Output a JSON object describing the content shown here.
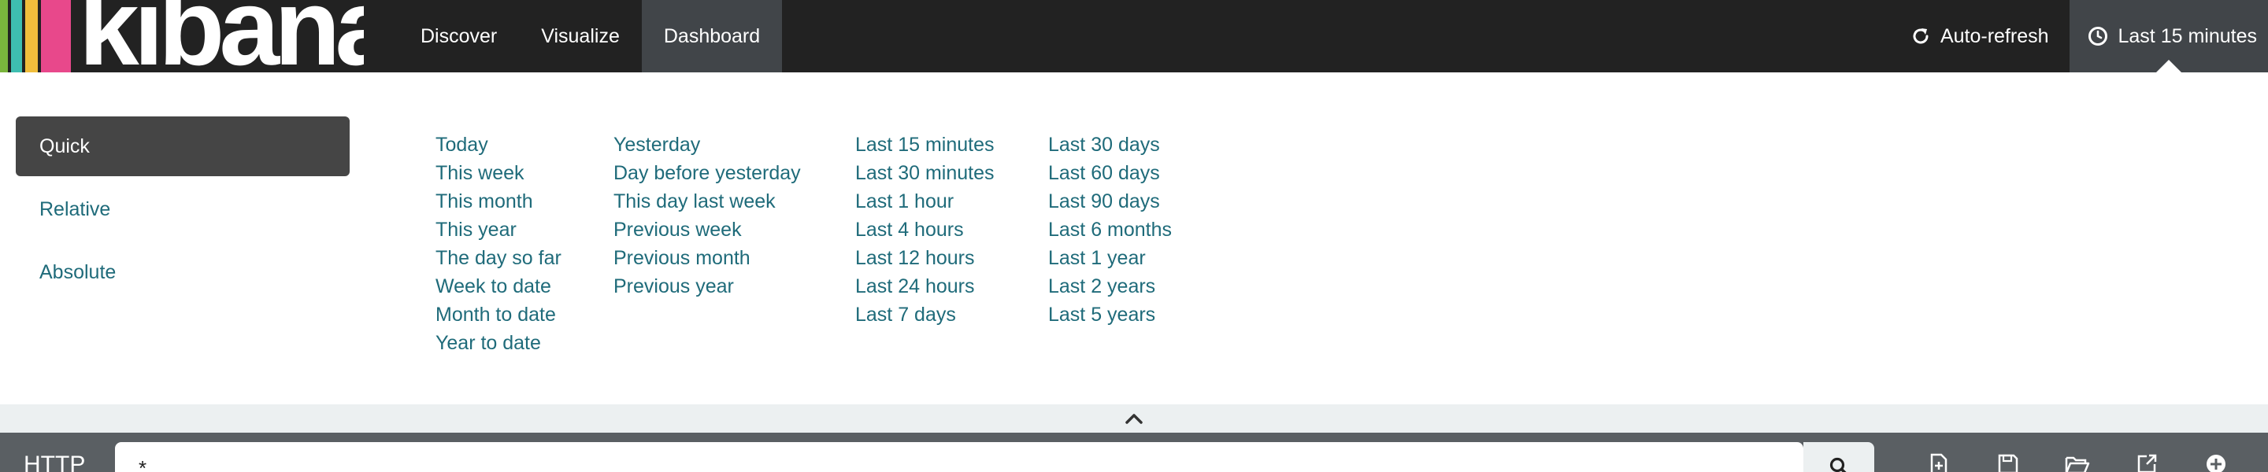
{
  "nav": {
    "logo_text": "kibana",
    "logo_stripes": [
      "#e8488b",
      "#f0be3c",
      "#3ebeb0",
      "#7ab53d"
    ],
    "tabs": [
      {
        "label": "Discover",
        "active": false
      },
      {
        "label": "Visualize",
        "active": false
      },
      {
        "label": "Dashboard",
        "active": true
      }
    ],
    "auto_refresh_label": "Auto-refresh",
    "timepicker_label": "Last 15 minutes",
    "icons": {
      "auto_refresh": "refresh-icon",
      "timepicker": "clock-icon"
    }
  },
  "timepicker": {
    "modes": [
      {
        "label": "Quick",
        "active": true
      },
      {
        "label": "Relative",
        "active": false
      },
      {
        "label": "Absolute",
        "active": false
      }
    ],
    "quick_columns": [
      [
        "Today",
        "This week",
        "This month",
        "This year",
        "The day so far",
        "Week to date",
        "Month to date",
        "Year to date"
      ],
      [
        "Yesterday",
        "Day before yesterday",
        "This day last week",
        "Previous week",
        "Previous month",
        "Previous year"
      ],
      [
        "Last 15 minutes",
        "Last 30 minutes",
        "Last 1 hour",
        "Last 4 hours",
        "Last 12 hours",
        "Last 24 hours",
        "Last 7 days"
      ],
      [
        "Last 30 days",
        "Last 60 days",
        "Last 90 days",
        "Last 6 months",
        "Last 1 year",
        "Last 2 years",
        "Last 5 years"
      ]
    ],
    "collapse_icon": "chevron-up-icon"
  },
  "query": {
    "label": "HTTP",
    "value": "*",
    "submit_icon": "search-icon",
    "tools": [
      "new-document-icon",
      "save-icon",
      "open-folder-icon",
      "share-icon",
      "add-panel-icon"
    ]
  },
  "colors": {
    "nav_bg": "#222222",
    "nav_active": "#414549",
    "link": "#1f6b7a",
    "mode_active_bg": "#454545",
    "collapse_bg": "#ecf0f1",
    "querybar_bg": "#5a5f63"
  }
}
